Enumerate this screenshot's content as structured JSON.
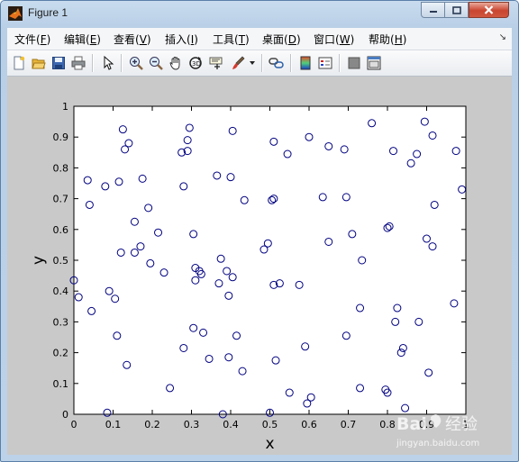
{
  "window": {
    "title": "Figure 1",
    "icon": "matlab-logo-icon"
  },
  "title_controls": [
    {
      "name": "minimize-button",
      "icon": "minimize-icon"
    },
    {
      "name": "maximize-button",
      "icon": "maximize-icon"
    },
    {
      "name": "close-button",
      "icon": "close-icon"
    }
  ],
  "menu": [
    {
      "label": "文件(",
      "key": "F",
      "suffix": ")"
    },
    {
      "label": "编辑(",
      "key": "E",
      "suffix": ")"
    },
    {
      "label": "查看(",
      "key": "V",
      "suffix": ")"
    },
    {
      "label": "插入(",
      "key": "I",
      "suffix": ")"
    },
    {
      "label": "工具(",
      "key": "T",
      "suffix": ")"
    },
    {
      "label": "桌面(",
      "key": "D",
      "suffix": ")"
    },
    {
      "label": "窗口(",
      "key": "W",
      "suffix": ")"
    },
    {
      "label": "帮助(",
      "key": "H",
      "suffix": ")"
    }
  ],
  "menu_dock_icon": "dock-arrow-icon",
  "toolbar": [
    "new-figure-icon",
    "open-file-icon",
    "save-icon",
    "print-icon",
    "pointer-icon",
    "zoom-in-icon",
    "zoom-out-icon",
    "pan-hand-icon",
    "rotate-3d-icon",
    "data-cursor-icon",
    "brush-icon",
    "link-plot-icon",
    "colorbar-icon",
    "legend-icon",
    "hide-plot-tools-icon",
    "show-plot-tools-icon"
  ],
  "chart_data": {
    "type": "scatter",
    "marker": "circle",
    "marker_color": "#000080",
    "xlabel": "x",
    "ylabel": "y",
    "xlim": [
      0,
      1
    ],
    "ylim": [
      0,
      1
    ],
    "xticks": [
      "0",
      "0.1",
      "0.2",
      "0.3",
      "0.4",
      "0.5",
      "0.6",
      "0.7",
      "0.8",
      "0.9",
      "1"
    ],
    "yticks": [
      "0",
      "0.1",
      "0.2",
      "0.3",
      "0.4",
      "0.5",
      "0.6",
      "0.7",
      "0.8",
      "0.9",
      "1"
    ],
    "grid": false,
    "background": "#c9c9c9",
    "axes_color": "#ffffff",
    "points": [
      [
        0.0,
        0.435
      ],
      [
        0.012,
        0.38
      ],
      [
        0.035,
        0.76
      ],
      [
        0.04,
        0.68
      ],
      [
        0.045,
        0.335
      ],
      [
        0.08,
        0.74
      ],
      [
        0.085,
        0.005
      ],
      [
        0.09,
        0.4
      ],
      [
        0.105,
        0.375
      ],
      [
        0.11,
        0.255
      ],
      [
        0.115,
        0.755
      ],
      [
        0.12,
        0.525
      ],
      [
        0.125,
        0.925
      ],
      [
        0.13,
        0.86
      ],
      [
        0.135,
        0.16
      ],
      [
        0.14,
        0.88
      ],
      [
        0.155,
        0.625
      ],
      [
        0.155,
        0.525
      ],
      [
        0.17,
        0.545
      ],
      [
        0.175,
        0.765
      ],
      [
        0.19,
        0.67
      ],
      [
        0.195,
        0.49
      ],
      [
        0.215,
        0.59
      ],
      [
        0.23,
        0.46
      ],
      [
        0.245,
        0.085
      ],
      [
        0.275,
        0.85
      ],
      [
        0.28,
        0.74
      ],
      [
        0.28,
        0.215
      ],
      [
        0.29,
        0.89
      ],
      [
        0.29,
        0.855
      ],
      [
        0.295,
        0.93
      ],
      [
        0.305,
        0.585
      ],
      [
        0.305,
        0.28
      ],
      [
        0.31,
        0.435
      ],
      [
        0.31,
        0.475
      ],
      [
        0.32,
        0.465
      ],
      [
        0.325,
        0.455
      ],
      [
        0.33,
        0.265
      ],
      [
        0.345,
        0.18
      ],
      [
        0.365,
        0.775
      ],
      [
        0.37,
        0.425
      ],
      [
        0.375,
        0.505
      ],
      [
        0.38,
        0.0
      ],
      [
        0.39,
        0.465
      ],
      [
        0.395,
        0.385
      ],
      [
        0.395,
        0.185
      ],
      [
        0.4,
        0.77
      ],
      [
        0.405,
        0.445
      ],
      [
        0.405,
        0.92
      ],
      [
        0.415,
        0.255
      ],
      [
        0.43,
        0.14
      ],
      [
        0.435,
        0.695
      ],
      [
        0.485,
        0.535
      ],
      [
        0.495,
        0.555
      ],
      [
        0.5,
        0.005
      ],
      [
        0.505,
        0.695
      ],
      [
        0.51,
        0.42
      ],
      [
        0.51,
        0.7
      ],
      [
        0.51,
        0.885
      ],
      [
        0.515,
        0.175
      ],
      [
        0.525,
        0.425
      ],
      [
        0.545,
        0.845
      ],
      [
        0.55,
        0.07
      ],
      [
        0.575,
        0.42
      ],
      [
        0.59,
        0.22
      ],
      [
        0.595,
        0.035
      ],
      [
        0.6,
        0.9
      ],
      [
        0.605,
        0.055
      ],
      [
        0.635,
        0.705
      ],
      [
        0.65,
        0.56
      ],
      [
        0.65,
        0.87
      ],
      [
        0.69,
        0.86
      ],
      [
        0.695,
        0.705
      ],
      [
        0.695,
        0.255
      ],
      [
        0.71,
        0.585
      ],
      [
        0.73,
        0.085
      ],
      [
        0.73,
        0.345
      ],
      [
        0.735,
        0.5
      ],
      [
        0.76,
        0.945
      ],
      [
        0.795,
        0.08
      ],
      [
        0.8,
        0.07
      ],
      [
        0.8,
        0.605
      ],
      [
        0.805,
        0.61
      ],
      [
        0.815,
        0.855
      ],
      [
        0.82,
        0.3
      ],
      [
        0.825,
        0.345
      ],
      [
        0.835,
        0.2
      ],
      [
        0.84,
        0.215
      ],
      [
        0.845,
        0.02
      ],
      [
        0.86,
        0.815
      ],
      [
        0.875,
        0.845
      ],
      [
        0.88,
        0.3
      ],
      [
        0.895,
        0.95
      ],
      [
        0.9,
        0.57
      ],
      [
        0.905,
        0.135
      ],
      [
        0.915,
        0.905
      ],
      [
        0.915,
        0.545
      ],
      [
        0.92,
        0.68
      ],
      [
        0.97,
        0.36
      ],
      [
        0.975,
        0.855
      ],
      [
        0.99,
        0.73
      ]
    ]
  },
  "watermark": {
    "line1": "Bai",
    "line2": "经验",
    "url": "jingyan.baidu.com"
  }
}
